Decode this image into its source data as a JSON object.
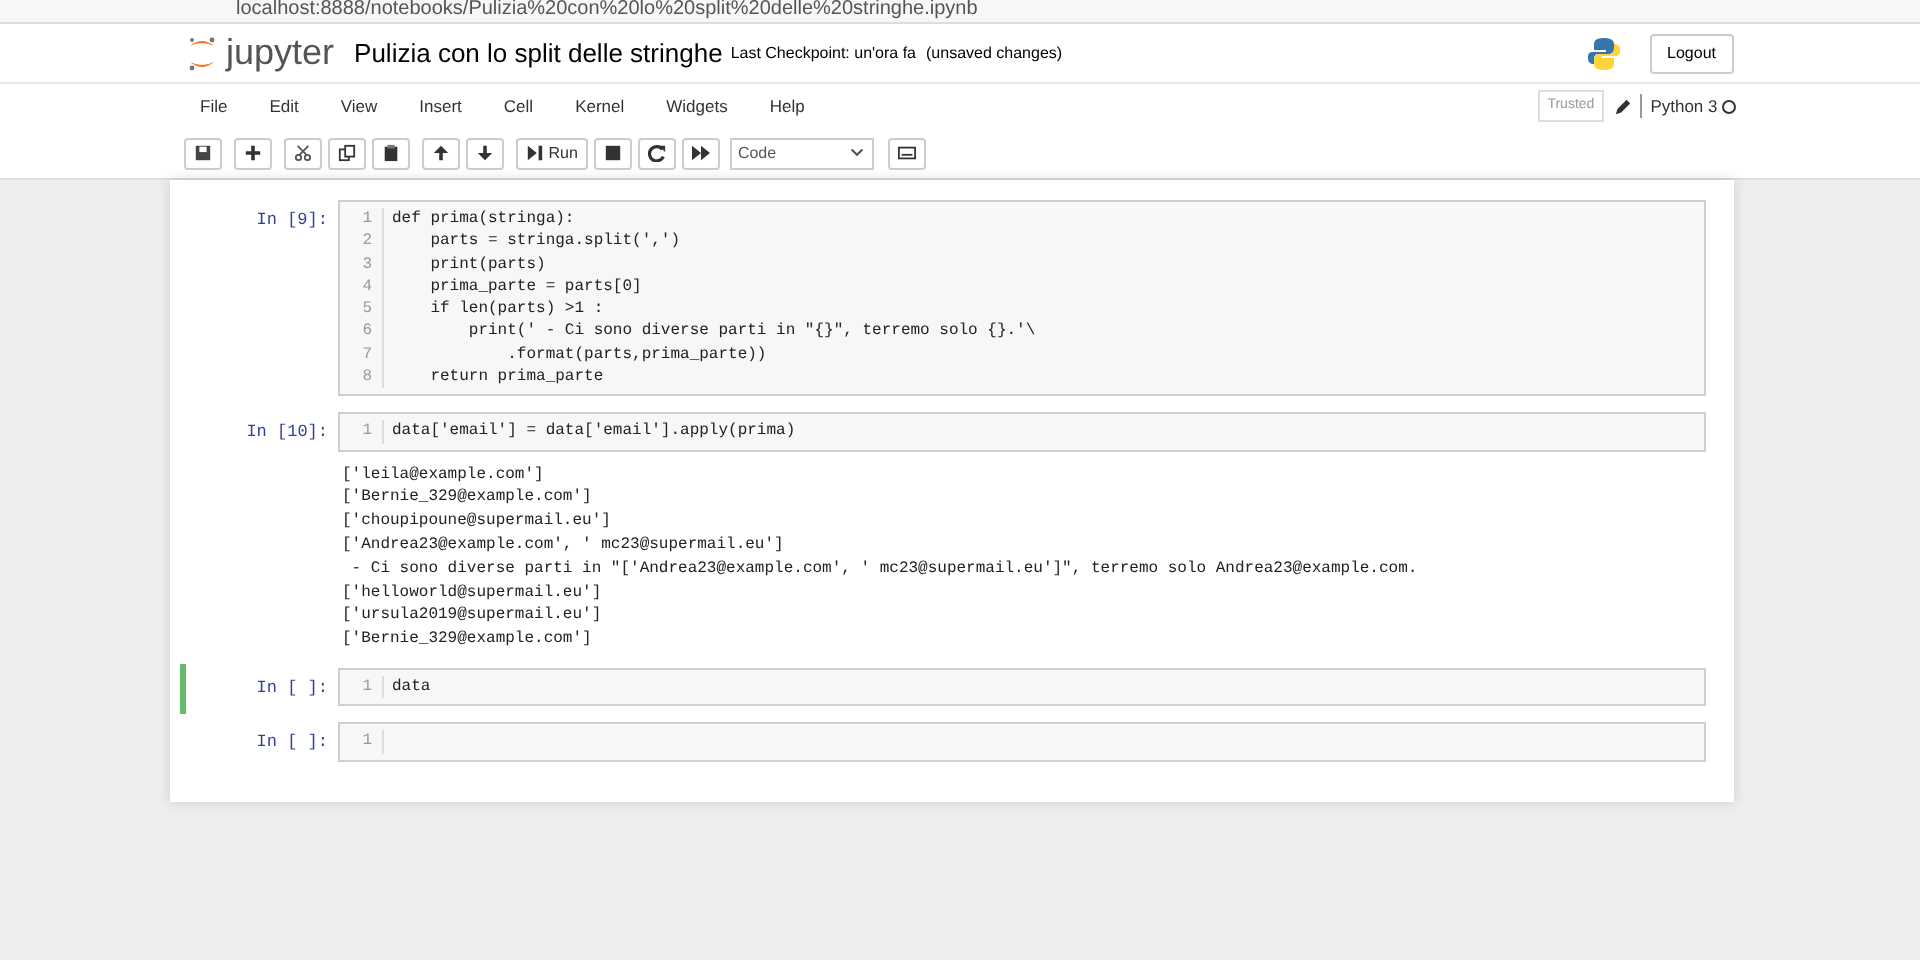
{
  "browser": {
    "url": "localhost:8888/notebooks/Pulizia%20con%20lo%20split%20delle%20stringhe.ipynb"
  },
  "header": {
    "logo": "jupyter",
    "title": "Pulizia con lo split delle stringhe",
    "checkpoint": "Last Checkpoint: un'ora fa",
    "unsaved": "(unsaved changes)",
    "logout": "Logout"
  },
  "menu": [
    "File",
    "Edit",
    "View",
    "Insert",
    "Cell",
    "Kernel",
    "Widgets",
    "Help"
  ],
  "toolbar": {
    "run": "Run",
    "cell_type": "Code",
    "trusted": "Trusted",
    "kernel": "Python 3"
  },
  "cells": [
    {
      "prompt": "In [9]:",
      "selected": false,
      "lines": [
        {
          "number": "1",
          "code": "def prima(stringa):"
        },
        {
          "number": "2",
          "code": "    parts = stringa.split(',')"
        },
        {
          "number": "3",
          "code": "    print(parts)"
        },
        {
          "number": "4",
          "code": "    prima_parte = parts[0]"
        },
        {
          "number": "5",
          "code": "    if len(parts) >1 :"
        },
        {
          "number": "6",
          "code": "        print(' - Ci sono diverse parti in \"{}\", terremo solo {}.'\\"
        },
        {
          "number": "7",
          "code": "            .format(parts,prima_parte))"
        },
        {
          "number": "8",
          "code": "    return prima_parte"
        }
      ]
    },
    {
      "prompt": "In [10]:",
      "selected": false,
      "lines": [
        {
          "number": "1",
          "code": "data['email'] = data['email'].apply(prima)"
        }
      ],
      "output": [
        "['leila@example.com']",
        "['Bernie_329@example.com']",
        "['choupipoune@supermail.eu']",
        "['Andrea23@example.com', ' mc23@supermail.eu']",
        " - Ci sono diverse parti in \"['Andrea23@example.com', ' mc23@supermail.eu']\", terremo solo Andrea23@example.com.",
        "['helloworld@supermail.eu']",
        "['ursula2019@supermail.eu']",
        "['Bernie_329@example.com']"
      ]
    },
    {
      "prompt": "In [ ]:",
      "selected": true,
      "lines": [
        {
          "number": "1",
          "code": "data"
        }
      ]
    },
    {
      "prompt": "In [ ]:",
      "selected": false,
      "lines": [
        {
          "number": "1"
        }
      ]
    }
  ]
}
